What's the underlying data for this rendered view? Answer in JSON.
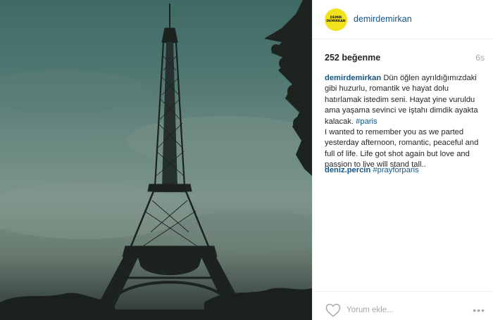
{
  "post": {
    "username": "demirdemirkan",
    "avatar_text_line1": "DEMIR",
    "avatar_text_line2": "DEMIRKAN",
    "avatar_color": "#f2e21c",
    "likes": "252 beğenme",
    "time": "6s",
    "caption": {
      "user": "demirdemirkan",
      "text_tr": "Dün öğlen ayrıldığımızdaki gibi huzurlu, romantik ve hayat dolu hatırlamak istedim seni. Hayat yine vuruldu ama yaşama sevinci ve iştahı dimdik ayakta kalacak.",
      "hashtag": "#paris",
      "text_en": "I wanted to remember you as we parted yesterday afternoon, romantic, peaceful and full of life. Life got shot again but love and passion to live will stand tall.."
    },
    "comment": {
      "user": "deniz.percin",
      "hashtag": "#prayforparis"
    },
    "comment_placeholder": "Yorum ekle...",
    "more_label": "•••",
    "link_color": "#125688"
  }
}
